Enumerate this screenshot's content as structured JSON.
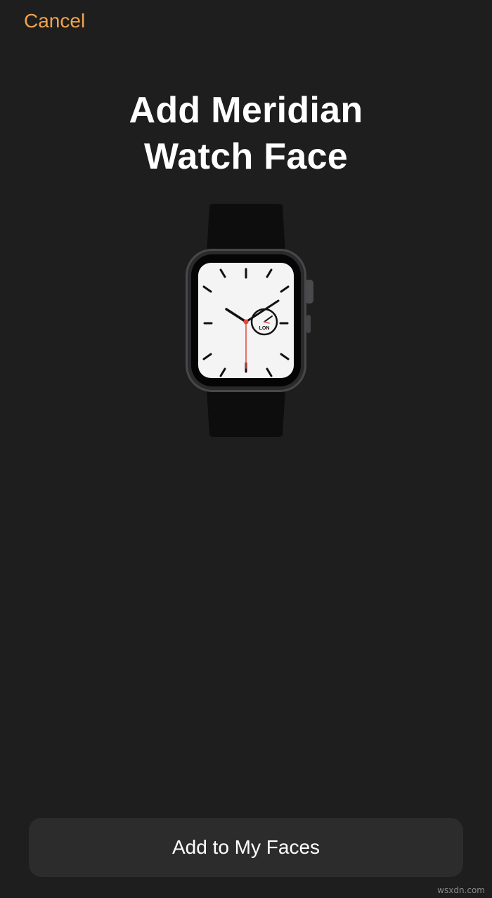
{
  "nav": {
    "cancel_label": "Cancel"
  },
  "header": {
    "title_line1": "Add Meridian",
    "title_line2": "Watch Face"
  },
  "watch_preview": {
    "face_name": "Meridian",
    "subdial_label": "LON",
    "accent_color": "#e0493a",
    "case_color": "#3a3a3c",
    "band_color": "#0d0d0d",
    "dial_color": "#f4f4f4"
  },
  "footer": {
    "add_button_label": "Add to My Faces"
  },
  "watermark": "wsxdn.com",
  "colors": {
    "background": "#1e1e1e",
    "accent_orange": "#f0a34e",
    "button_bg": "#2c2c2d",
    "text_white": "#ffffff"
  }
}
